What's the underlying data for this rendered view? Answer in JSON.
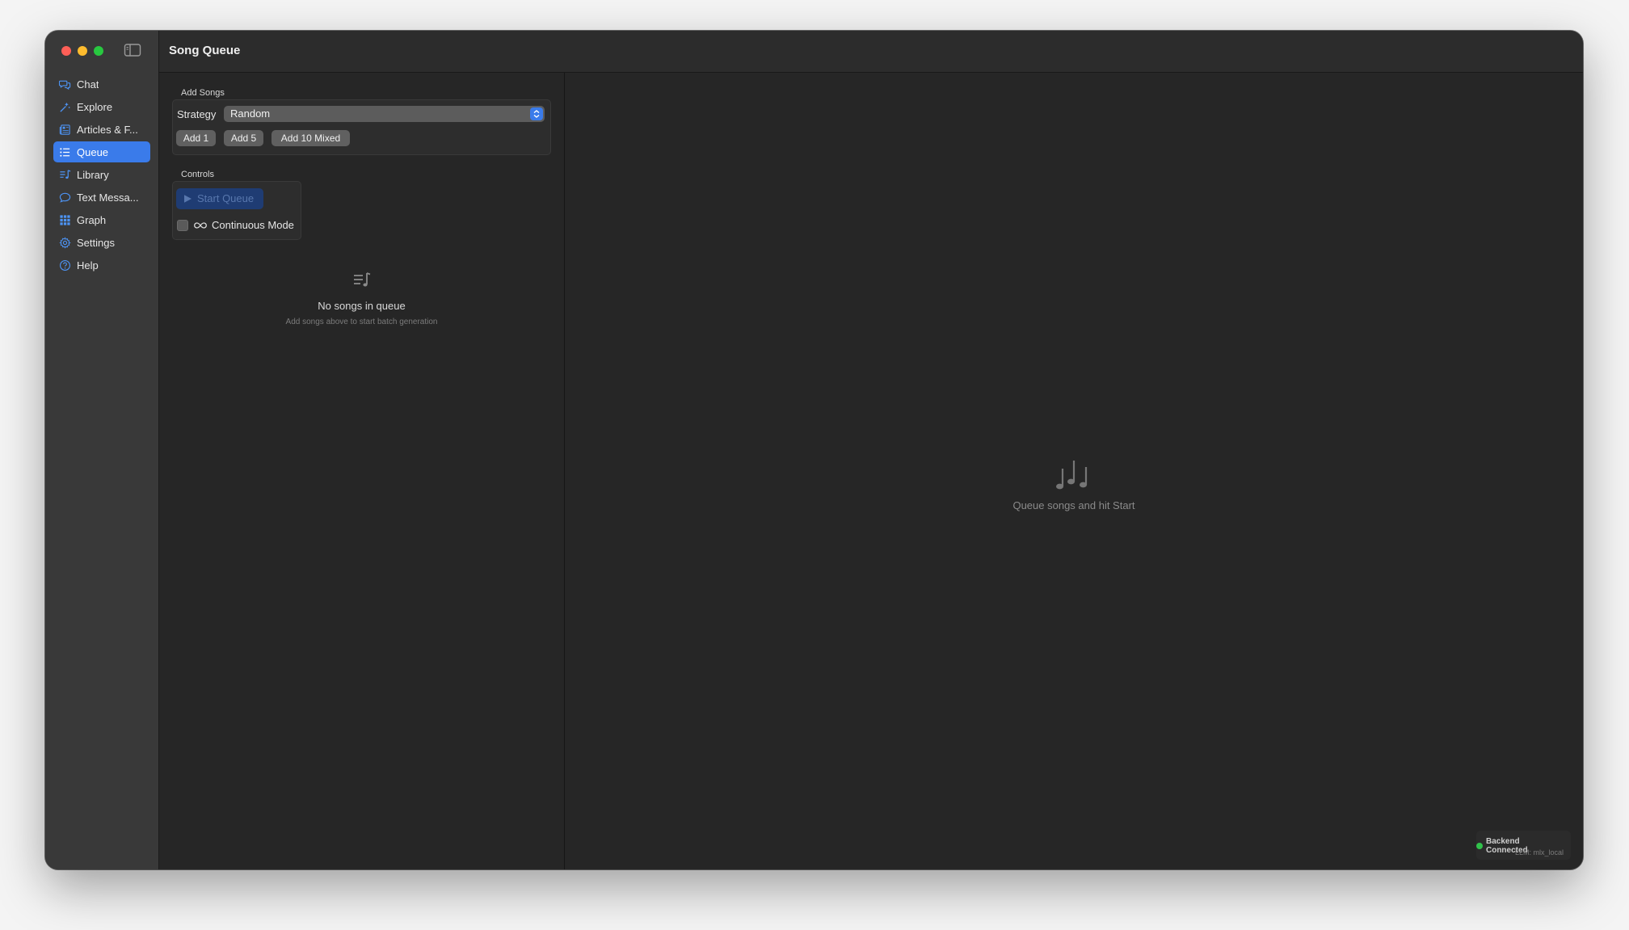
{
  "window": {
    "title": "Song Queue"
  },
  "sidebar": {
    "items": [
      {
        "label": "Chat",
        "icon": "chat-bubbles-icon"
      },
      {
        "label": "Explore",
        "icon": "explore-sparkle-icon"
      },
      {
        "label": "Articles & F...",
        "icon": "newspaper-icon"
      },
      {
        "label": "Queue",
        "icon": "list-bullet-icon",
        "active": true
      },
      {
        "label": "Library",
        "icon": "music-library-icon"
      },
      {
        "label": "Text Messa...",
        "icon": "message-bubble-icon"
      },
      {
        "label": "Graph",
        "icon": "grid-graph-icon"
      },
      {
        "label": "Settings",
        "icon": "gear-icon"
      },
      {
        "label": "Help",
        "icon": "question-circle-icon"
      }
    ]
  },
  "queue_panel": {
    "add_songs": {
      "section_label": "Add Songs",
      "strategy_label": "Strategy",
      "strategy_value": "Random",
      "buttons": [
        "Add 1",
        "Add 5",
        "Add 10 Mixed"
      ]
    },
    "controls": {
      "section_label": "Controls",
      "start_label": "Start Queue",
      "continuous_label": "Continuous Mode",
      "continuous_checked": false
    },
    "empty_state": {
      "title": "No songs in queue",
      "subtitle": "Add songs above to start batch generation"
    }
  },
  "main": {
    "empty_text": "Queue songs and hit Start"
  },
  "status": {
    "connection": "Backend Connected",
    "llm": "LLM: mlx_local"
  },
  "colors": {
    "accent": "#3a7bea",
    "connected": "#31c24b",
    "close": "#fe5f57",
    "minimize": "#febc2e",
    "zoom": "#28c840"
  }
}
